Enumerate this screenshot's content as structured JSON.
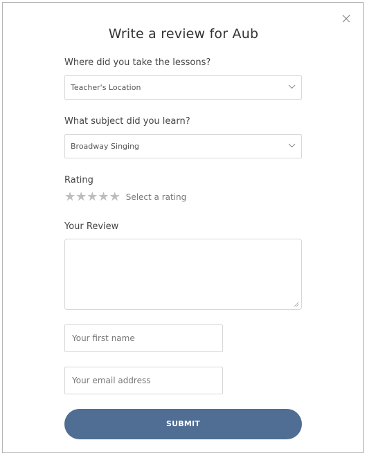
{
  "modal": {
    "title": "Write a review for Aub",
    "close_icon": "close-icon"
  },
  "location": {
    "label": "Where did you take the lessons?",
    "selected": "Teacher's Location"
  },
  "subject": {
    "label": "What subject did you learn?",
    "selected": "Broadway Singing"
  },
  "rating": {
    "label": "Rating",
    "max_stars": 5,
    "value": 0,
    "hint": "Select a rating",
    "star_color": "#bdbdbd"
  },
  "review": {
    "label": "Your Review",
    "value": ""
  },
  "first_name": {
    "placeholder": "Your first name",
    "value": ""
  },
  "email": {
    "placeholder": "Your email address",
    "value": ""
  },
  "submit": {
    "label": "SUBMIT",
    "color": "#506e94"
  }
}
